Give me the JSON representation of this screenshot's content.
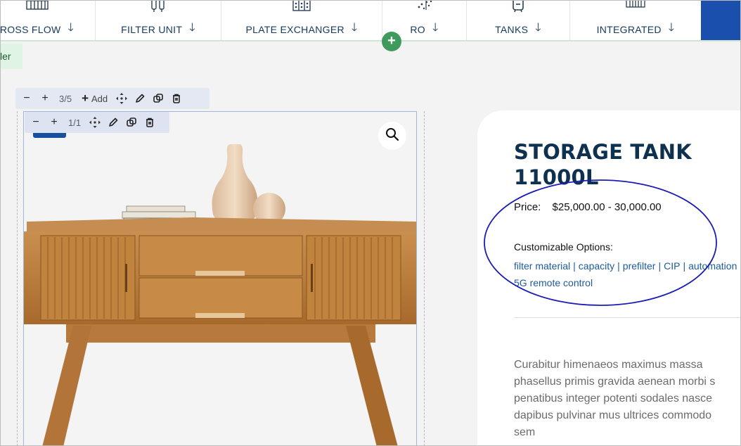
{
  "nav": {
    "items": [
      {
        "label": "ROSS FLOW",
        "icon": "filter-rack-icon"
      },
      {
        "label": "FILTER UNIT",
        "icon": "twin-filter-icon"
      },
      {
        "label": "PLATE EXCHANGER",
        "icon": "plate-exchanger-icon"
      },
      {
        "label": "RO",
        "icon": "ro-membrane-icon"
      },
      {
        "label": "TANKS",
        "icon": "tank-icon"
      },
      {
        "label": "INTEGRATED",
        "icon": "integrated-system-icon"
      }
    ],
    "arrow": "🡓",
    "add_section": "+"
  },
  "page_tag": "ler",
  "toolbar_outer": {
    "minus": "−",
    "plus": "+",
    "count": "3/5",
    "add_label": "Add"
  },
  "toolbar_inner": {
    "minus": "−",
    "plus": "+",
    "count": "1/1"
  },
  "product": {
    "title": "STORAGE TANK 11000L",
    "price_label": "Price:",
    "price_value": "$25,000.00 - 30,000.00",
    "options_label": "Customizable Options:",
    "options": [
      "filter material",
      "capacity",
      "prefilter",
      "CIP",
      "automation"
    ],
    "options_line2": "5G remote control",
    "description_lines": [
      "Curabitur himenaeos maximus massa",
      "phasellus primis gravida aenean morbi s",
      "penatibus integer potenti sodales nasce",
      "dapibus pulvinar mus ultrices commodo",
      "sem"
    ]
  },
  "colors": {
    "nav_text": "#14395f",
    "cta": "#1a4fae",
    "add_button": "#3f9a5d",
    "title": "#0f3150",
    "link": "#1d5a9e",
    "annotation_ellipse": "#1b1bb5"
  }
}
